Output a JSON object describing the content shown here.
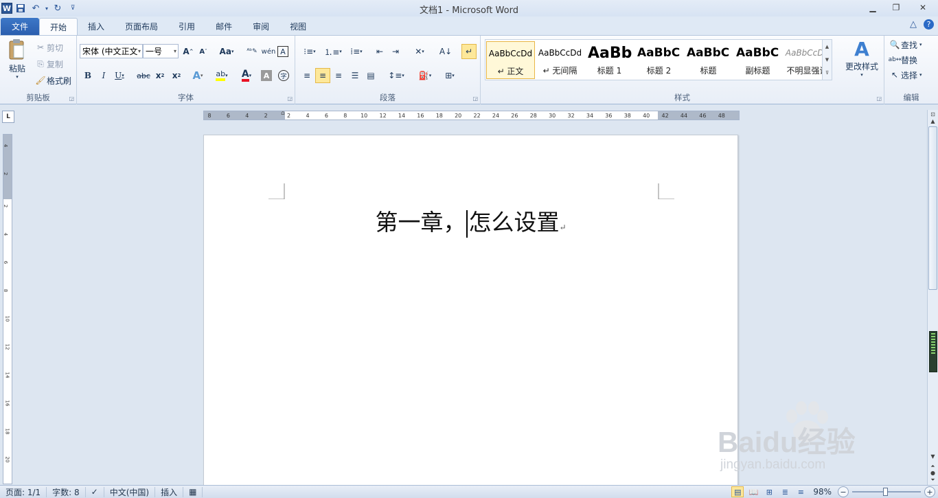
{
  "window": {
    "title": "文档1 - Microsoft Word"
  },
  "tabs": {
    "file": "文件",
    "items": [
      "开始",
      "插入",
      "页面布局",
      "引用",
      "邮件",
      "审阅",
      "视图"
    ]
  },
  "clipboard": {
    "paste": "粘贴",
    "cut": "剪切",
    "copy": "复制",
    "format_painter": "格式刷",
    "group": "剪贴板"
  },
  "font": {
    "name": "宋体 (中文正文",
    "size": "一号",
    "group": "字体",
    "grow": "A",
    "shrink": "A",
    "case": "Aa",
    "bold": "B",
    "italic": "I",
    "underline": "U",
    "strike": "abc",
    "subscript": "x",
    "superscript": "x",
    "text_effects": "A",
    "highlight": "ab",
    "font_color": "A",
    "char_shading": "A",
    "font_color_hex": "#e81123",
    "highlight_hex": "#ffff00"
  },
  "paragraph": {
    "group": "段落"
  },
  "styles": {
    "group": "样式",
    "change": "更改样式",
    "items": [
      {
        "sample": "AaBbCcDd",
        "name": "↵ 正文",
        "selected": true
      },
      {
        "sample": "AaBbCcDd",
        "name": "↵ 无间隔",
        "selected": false
      },
      {
        "sample": "AaBb",
        "name": "标题 1",
        "selected": false
      },
      {
        "sample": "AaBbC",
        "name": "标题 2",
        "selected": false
      },
      {
        "sample": "AaBbC",
        "name": "标题",
        "selected": false
      },
      {
        "sample": "AaBbC",
        "name": "副标题",
        "selected": false
      },
      {
        "sample": "AaBbCcDd",
        "name": "不明显强调",
        "selected": false
      }
    ]
  },
  "editing": {
    "group": "编辑",
    "find": "查找",
    "replace": "替换",
    "select": "选择"
  },
  "ruler": {
    "corner": "L",
    "ticks": [
      "8",
      "6",
      "4",
      "2",
      "2",
      "4",
      "6",
      "8",
      "10",
      "12",
      "14",
      "16",
      "18",
      "20",
      "22",
      "24",
      "26",
      "28",
      "30",
      "32",
      "34",
      "36",
      "38",
      "40",
      "42",
      "44",
      "46",
      "48"
    ],
    "vticks": [
      "4",
      "2",
      "2",
      "4",
      "6",
      "8",
      "10",
      "12",
      "14",
      "16",
      "18",
      "20"
    ]
  },
  "document": {
    "heading_before": "第一章，",
    "heading_after": "怎么设置",
    "pilcrow": "↵"
  },
  "status": {
    "page": "页面: 1/1",
    "words": "字数: 8",
    "language": "中文(中国)",
    "mode": "插入",
    "zoom": "98%",
    "zoom_value": 0.98
  },
  "watermark": {
    "brand": "Baidu经验",
    "url": "jingyan.baidu.com"
  }
}
